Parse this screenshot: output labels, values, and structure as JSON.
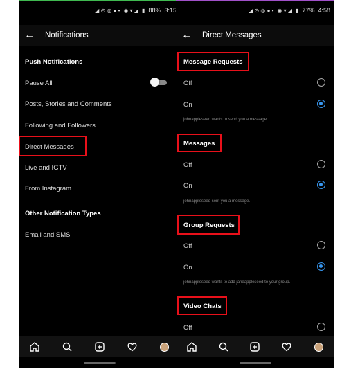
{
  "colors": {
    "background": "#000000",
    "highlight": "#e8101a",
    "accent": "#3897f0",
    "left_strip": "#3fb950",
    "right_strip": "#a050c8"
  },
  "left": {
    "status": {
      "battery": "88%",
      "time": "3:15"
    },
    "title": "Notifications",
    "sections": [
      {
        "label": "Push Notifications"
      },
      {
        "label": "Other Notification Types"
      }
    ],
    "items": [
      {
        "label": "Pause All"
      },
      {
        "label": "Posts, Stories and Comments"
      },
      {
        "label": "Following and Followers"
      },
      {
        "label": "Direct Messages"
      },
      {
        "label": "Live and IGTV"
      },
      {
        "label": "From Instagram"
      },
      {
        "label": "Email and SMS"
      }
    ],
    "pause_all_on": false
  },
  "right": {
    "status": {
      "battery": "77%",
      "time": "4:58"
    },
    "title": "Direct Messages",
    "groups": [
      {
        "title": "Message Requests",
        "off": "Off",
        "on": "On",
        "note": "johnappleseed wants to send you a message.",
        "selected": "On"
      },
      {
        "title": "Messages",
        "off": "Off",
        "on": "On",
        "note": "johnappleseed sent you a message.",
        "selected": "On"
      },
      {
        "title": "Group Requests",
        "off": "Off",
        "on": "On",
        "note": "johnappleseed wants to add janeappleseed to your group.",
        "selected": "On"
      },
      {
        "title": "Video Chats",
        "off": "Off"
      }
    ]
  },
  "nav": [
    "home-icon",
    "search-icon",
    "add-post-icon",
    "activity-heart-icon",
    "profile-avatar-icon"
  ]
}
